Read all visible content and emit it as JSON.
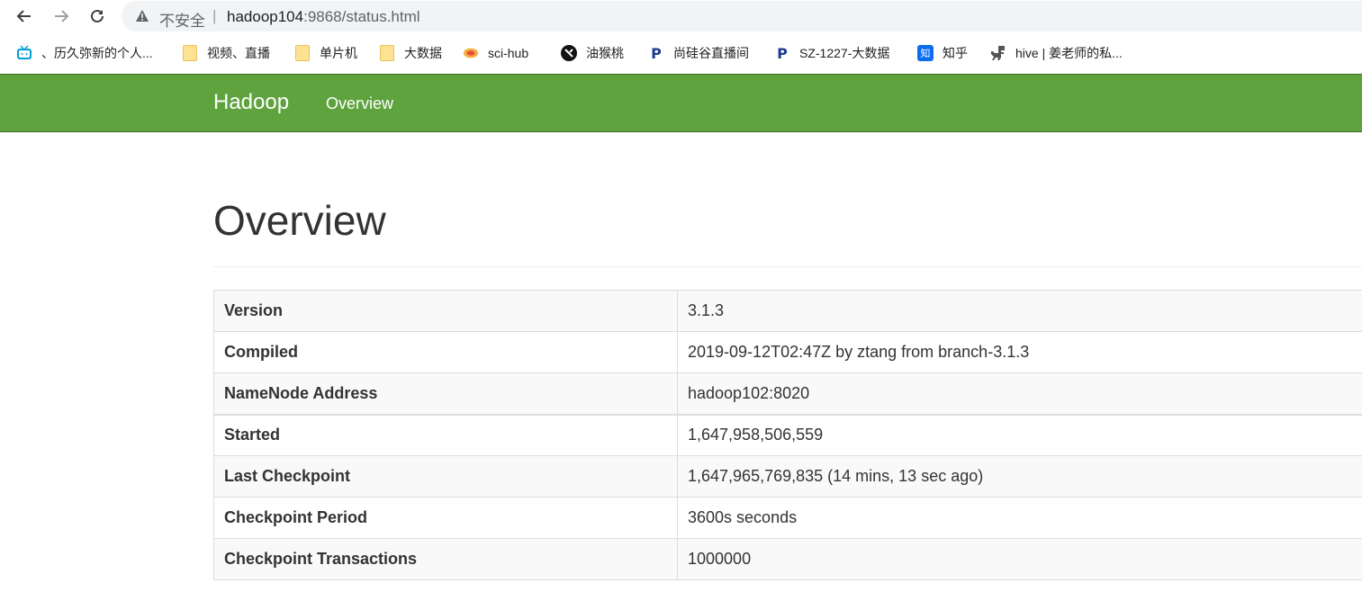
{
  "browser": {
    "security_label": "不安全",
    "separator": "|",
    "url_host": "hadoop104",
    "url_path": ":9868/status.html"
  },
  "bookmarks": [
    {
      "label": "、历久弥新的个人...",
      "icon": "bilibili-icon"
    },
    {
      "label": "视频、直播",
      "icon": "folder-icon"
    },
    {
      "label": "单片机",
      "icon": "folder-icon"
    },
    {
      "label": "大数据",
      "icon": "folder-icon"
    },
    {
      "label": "sci-hub",
      "icon": "sci-hub-icon"
    },
    {
      "label": "油猴桃",
      "icon": "tampermonkey-icon"
    },
    {
      "label": "尚硅谷直播间",
      "icon": "p-logo-icon"
    },
    {
      "label": "SZ-1227-大数据",
      "icon": "p-logo-icon"
    },
    {
      "label": "知乎",
      "icon": "zhihu-icon"
    },
    {
      "label": "hive | 姜老师的私...",
      "icon": "dino-icon"
    }
  ],
  "navbar": {
    "brand": "Hadoop",
    "link": "Overview",
    "color": "#5fa33e"
  },
  "page": {
    "title": "Overview"
  },
  "overview": [
    {
      "key": "Version",
      "value": "3.1.3"
    },
    {
      "key": "Compiled",
      "value": "2019-09-12T02:47Z by ztang from branch-3.1.3"
    },
    {
      "key": "NameNode Address",
      "value": "hadoop102:8020"
    },
    {
      "key": "Started",
      "value": "1,647,958,506,559"
    },
    {
      "key": "Last Checkpoint",
      "value": "1,647,965,769,835 (14 mins, 13 sec ago)"
    },
    {
      "key": "Checkpoint Period",
      "value": "3600s seconds"
    },
    {
      "key": "Checkpoint Transactions",
      "value": "1000000"
    }
  ]
}
